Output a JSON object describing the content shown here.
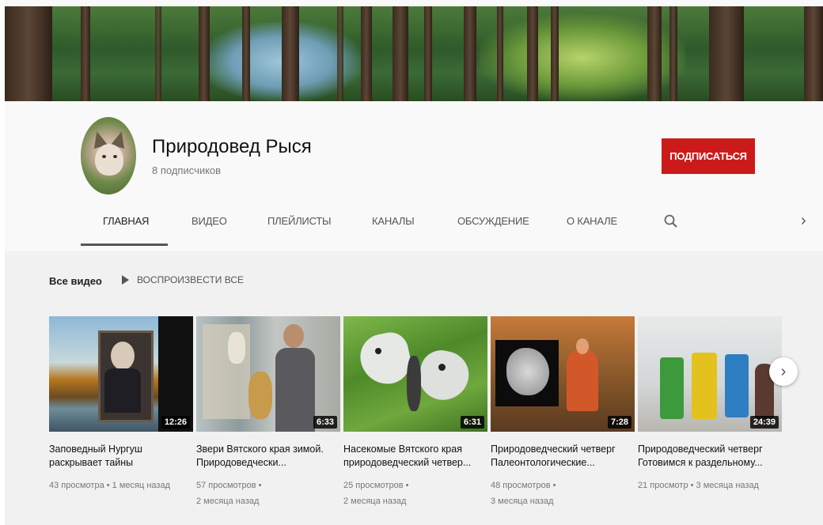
{
  "channel": {
    "name": "Природовед Рыся",
    "subscribers": "8 подписчиков",
    "subscribe_label": "ПОДПИСАТЬСЯ"
  },
  "tabs": [
    {
      "label": "ГЛАВНАЯ",
      "active": true
    },
    {
      "label": "ВИДЕО",
      "active": false
    },
    {
      "label": "ПЛЕЙЛИСТЫ",
      "active": false
    },
    {
      "label": "КАНАЛЫ",
      "active": false
    },
    {
      "label": "ОБСУЖДЕНИЕ",
      "active": false
    },
    {
      "label": "О КАНАЛЕ",
      "active": false
    }
  ],
  "section": {
    "title": "Все видео",
    "play_all_label": "ВОСПРОИЗВЕСТИ ВСЕ"
  },
  "videos": [
    {
      "title": "Заповедный Нургуш раскрывает тайны",
      "duration": "12:26",
      "views": "43 просмотра",
      "age": "1 месяц назад"
    },
    {
      "title": "Звери Вятского края зимой. Природоведчески...",
      "duration": "6:33",
      "views": "57 просмотров",
      "age": "2 месяца назад"
    },
    {
      "title": "Насекомые Вятского края природоведческий четвер...",
      "duration": "6:31",
      "views": "25 просмотров",
      "age": "2 месяца назад"
    },
    {
      "title": "Природоведческий четверг Палеонтологические...",
      "duration": "7:28",
      "views": "48 просмотров",
      "age": "3 месяца назад"
    },
    {
      "title": "Природоведческий четверг Готовимся к раздельному...",
      "duration": "24:39",
      "views": "21 просмотр",
      "age": "3 месяца назад"
    }
  ],
  "colors": {
    "subscribe": "#cc1a1a",
    "tab_indicator": "#555555"
  },
  "icons": [
    "search-icon",
    "chevron-right-icon",
    "play-icon"
  ]
}
